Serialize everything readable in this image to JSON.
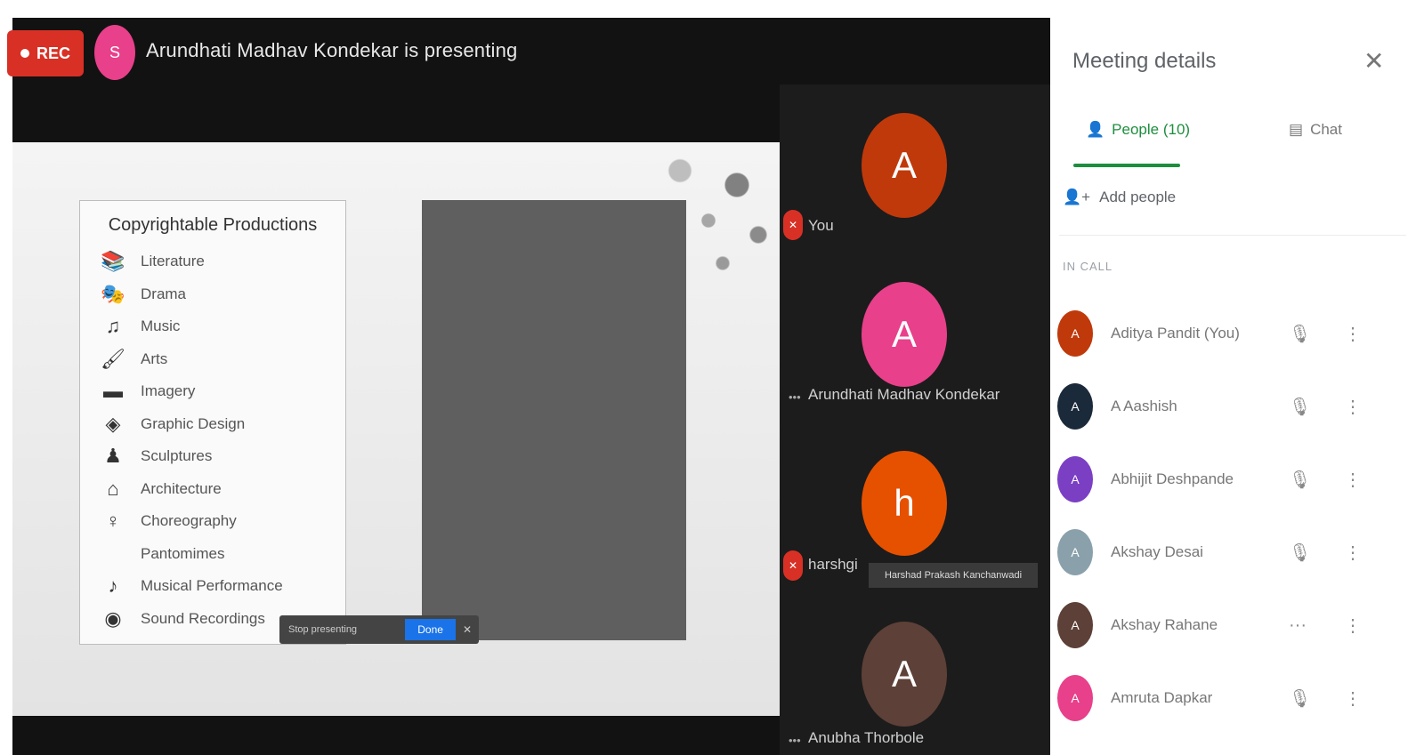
{
  "header": {
    "rec_label": "REC",
    "presenter_initial": "S",
    "presenting_text": "Arundhati Madhav Kondekar is presenting"
  },
  "slide": {
    "title": "Copyrightable Productions",
    "items": [
      {
        "icon": "books-icon",
        "glyph": "📚",
        "label": "Literature"
      },
      {
        "icon": "drama-icon",
        "glyph": "🎭",
        "label": "Drama"
      },
      {
        "icon": "music-icon",
        "glyph": "♫",
        "label": "Music"
      },
      {
        "icon": "art-icon",
        "glyph": "🖌",
        "label": "Arts"
      },
      {
        "icon": "imagery-icon",
        "glyph": "▬",
        "label": "Imagery"
      },
      {
        "icon": "graphic-design-icon",
        "glyph": "◈",
        "label": "Graphic Design"
      },
      {
        "icon": "sculpture-icon",
        "glyph": "♟",
        "label": "Sculptures"
      },
      {
        "icon": "architecture-icon",
        "glyph": "⌂",
        "label": "Architecture"
      },
      {
        "icon": "choreography-icon",
        "glyph": "♀",
        "label": "Choreography"
      },
      {
        "icon": "pantomime-icon",
        "glyph": "",
        "label": "Pantomimes"
      },
      {
        "icon": "musical-performance-icon",
        "glyph": "♪",
        "label": "Musical Performance"
      },
      {
        "icon": "sound-recording-icon",
        "glyph": "◉",
        "label": "Sound Recordings"
      }
    ],
    "tooltip_text": "Stop presenting",
    "tooltip_button": "Done"
  },
  "tiles": [
    {
      "initial": "A",
      "color": "#c0390b",
      "name": "You",
      "muted": true
    },
    {
      "initial": "A",
      "color": "#e8408a",
      "name": "Arundhati Madhav Kondekar",
      "muted": false
    },
    {
      "initial": "h",
      "color": "#e65100",
      "name": "harshgi",
      "muted": true
    },
    {
      "initial": "A",
      "color": "#5d4037",
      "name": "Anubha Thorbole",
      "muted": false
    }
  ],
  "tile_tooltip": "Harshad Prakash Kanchanwadi",
  "sidebar": {
    "title": "Meeting details",
    "tab_people": "People (10)",
    "tab_chat": "Chat",
    "add_people": "Add people",
    "section_label": "IN CALL",
    "participants": [
      {
        "initial": "A",
        "color": "#c0390b",
        "name": "Aditya Pandit (You)"
      },
      {
        "initial": "A",
        "color": "#1b2a3a",
        "name": "A Aashish"
      },
      {
        "initial": "A",
        "color": "#7b3fc4",
        "name": "Abhijit Deshpande"
      },
      {
        "initial": "A",
        "color": "#8aa1ac",
        "name": "Akshay Desai"
      },
      {
        "initial": "A",
        "color": "#5d4037",
        "name": "Akshay Rahane"
      },
      {
        "initial": "A",
        "color": "#e8408a",
        "name": "Amruta Dapkar"
      }
    ]
  }
}
